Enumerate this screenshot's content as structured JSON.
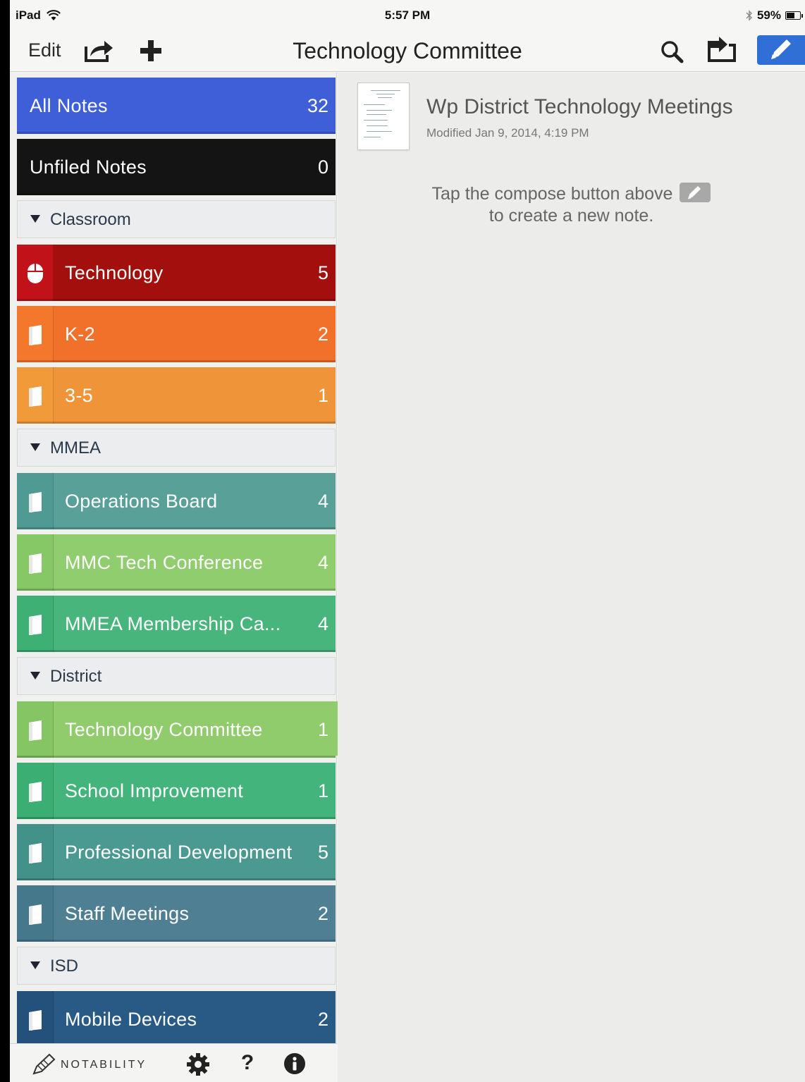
{
  "status": {
    "device": "iPad",
    "time": "5:57 PM",
    "battery": "59%",
    "battery_level": 0.59
  },
  "navbar": {
    "edit": "Edit",
    "title": "Technology Committee"
  },
  "sidebar": {
    "all_notes": {
      "label": "All Notes",
      "count": "32",
      "color": "#3f5fd9"
    },
    "unfiled": {
      "label": "Unfiled Notes",
      "count": "0",
      "color": "#141414"
    },
    "sections": [
      {
        "label": "Classroom",
        "items": [
          {
            "label": "Technology",
            "count": "5",
            "color": "#a30f0c",
            "tab": "#c1121a",
            "icon": "mouse-icon"
          },
          {
            "label": "K-2",
            "count": "2",
            "color": "#f1702a",
            "tab": "#f4782c",
            "icon": "notebook-icon"
          },
          {
            "label": "3-5",
            "count": "1",
            "color": "#ef9438",
            "tab": "#f09a3a",
            "icon": "notebook-icon"
          }
        ]
      },
      {
        "label": "MMEA",
        "items": [
          {
            "label": "Operations Board",
            "count": "4",
            "color": "#58a098",
            "tab": "#4f9a92",
            "icon": "notebook-icon"
          },
          {
            "label": "MMC Tech Conference",
            "count": "4",
            "color": "#8fcd6e",
            "tab": "#86c866",
            "icon": "notebook-icon"
          },
          {
            "label": "MMEA Membership Ca...",
            "count": "4",
            "color": "#47b57c",
            "tab": "#3fb074",
            "icon": "notebook-icon"
          }
        ]
      },
      {
        "label": "District",
        "items": [
          {
            "label": "Technology Committee",
            "count": "1",
            "color": "#90cb6c",
            "tab": "#86c564",
            "icon": "notebook-icon"
          },
          {
            "label": "School Improvement",
            "count": "1",
            "color": "#43b57c",
            "tab": "#3aae73",
            "icon": "notebook-icon"
          },
          {
            "label": "Professional Development",
            "count": "5",
            "color": "#4a9a92",
            "tab": "#42928a",
            "icon": "notebook-icon"
          },
          {
            "label": "Staff Meetings",
            "count": "2",
            "color": "#4f7f93",
            "tab": "#46788c",
            "icon": "notebook-icon"
          }
        ]
      },
      {
        "label": "ISD",
        "items": [
          {
            "label": "Mobile Devices",
            "count": "2",
            "color": "#295a86",
            "tab": "#23517b",
            "icon": "notebook-icon"
          }
        ]
      }
    ]
  },
  "bottombar": {
    "brand": "NOTABILITY",
    "help": "?"
  },
  "note": {
    "title": "Wp District Technology Meetings",
    "modified": "Modified Jan 9, 2014, 4:19 PM"
  },
  "hint": {
    "line1": "Tap the compose button above",
    "line2": "to create a new note."
  },
  "colors": {
    "accent": "#2f6fd6"
  }
}
